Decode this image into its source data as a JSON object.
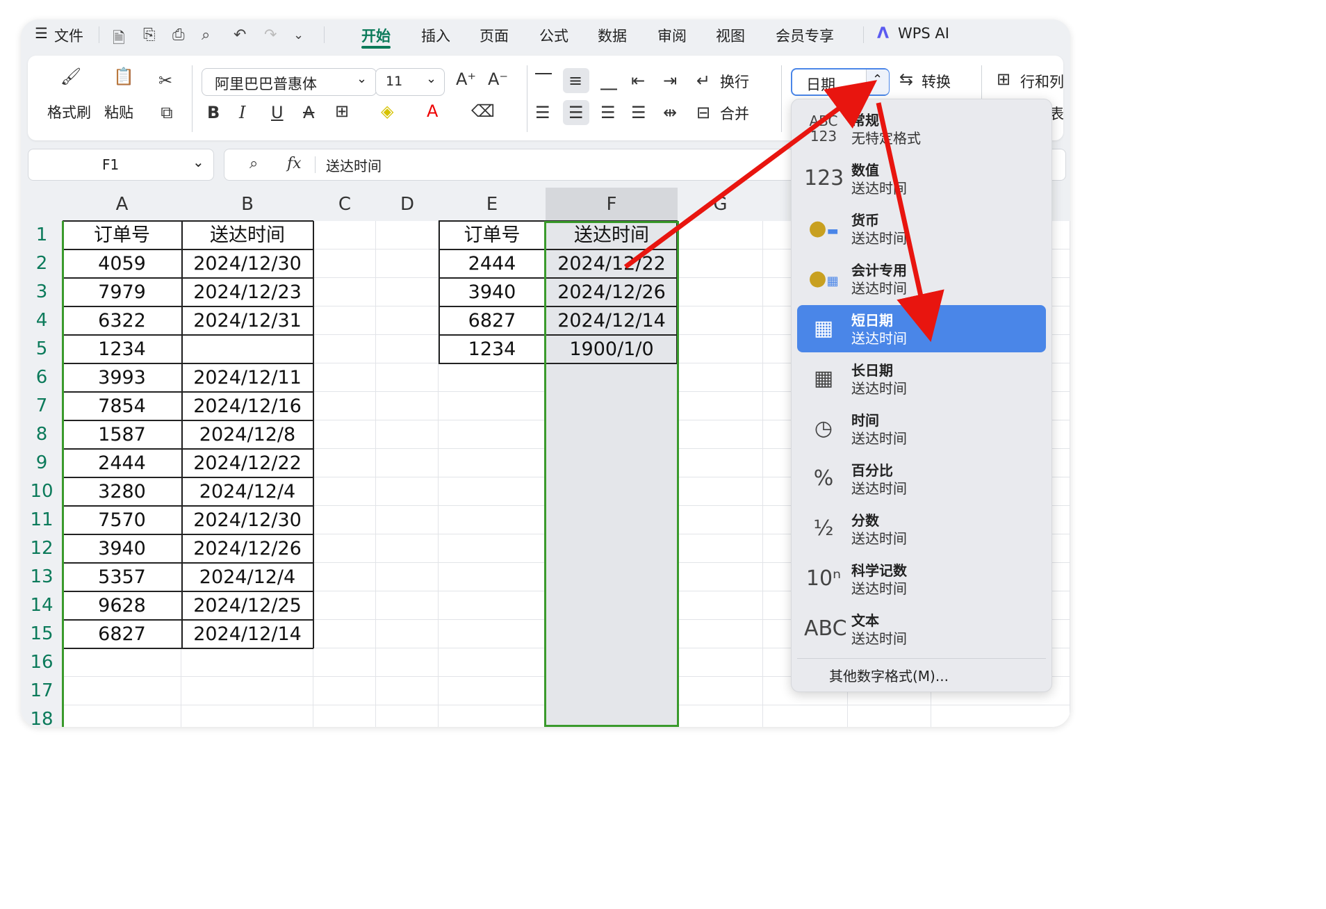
{
  "menu": {
    "hamburger": "☰",
    "file": "文件",
    "tabs": [
      "开始",
      "插入",
      "页面",
      "公式",
      "数据",
      "审阅",
      "视图",
      "会员专享"
    ],
    "active_tab": "开始",
    "ai": "WPS AI"
  },
  "ribbon": {
    "format_painter": "格式刷",
    "paste": "粘贴",
    "font_name": "阿里巴巴普惠体",
    "font_size": "11",
    "wrap": "换行",
    "merge": "合并",
    "number_format": "日期",
    "convert": "转换",
    "row_col": "行和列",
    "table_partial": "表"
  },
  "formula_bar": {
    "cell_ref": "F1",
    "fx": "fx",
    "content": "送达时间"
  },
  "sheet": {
    "columns": [
      "A",
      "B",
      "C",
      "D",
      "E",
      "F",
      "G"
    ],
    "rows": [
      "1",
      "2",
      "3",
      "4",
      "5",
      "6",
      "7",
      "8",
      "9",
      "10",
      "11",
      "12",
      "13",
      "14",
      "15",
      "16",
      "17",
      "18"
    ],
    "table1": {
      "headers": [
        "订单号",
        "送达时间"
      ],
      "rows": [
        [
          "4059",
          "2024/12/30"
        ],
        [
          "7979",
          "2024/12/23"
        ],
        [
          "6322",
          "2024/12/31"
        ],
        [
          "1234",
          ""
        ],
        [
          "3993",
          "2024/12/11"
        ],
        [
          "7854",
          "2024/12/16"
        ],
        [
          "1587",
          "2024/12/8"
        ],
        [
          "2444",
          "2024/12/22"
        ],
        [
          "3280",
          "2024/12/4"
        ],
        [
          "7570",
          "2024/12/30"
        ],
        [
          "3940",
          "2024/12/26"
        ],
        [
          "5357",
          "2024/12/4"
        ],
        [
          "9628",
          "2024/12/25"
        ],
        [
          "6827",
          "2024/12/14"
        ]
      ]
    },
    "table2": {
      "headers": [
        "订单号",
        "送达时间"
      ],
      "rows": [
        [
          "2444",
          "2024/12/22"
        ],
        [
          "3940",
          "2024/12/26"
        ],
        [
          "6827",
          "2024/12/14"
        ],
        [
          "1234",
          "1900/1/0"
        ]
      ]
    }
  },
  "dropdown": {
    "items": [
      {
        "icon": "ABC123",
        "name": "常规",
        "sub": "无特定格式"
      },
      {
        "icon": "123",
        "name": "数值",
        "sub": "送达时间"
      },
      {
        "icon": "coins",
        "name": "货币",
        "sub": "送达时间"
      },
      {
        "icon": "coins-calc",
        "name": "会计专用",
        "sub": "送达时间"
      },
      {
        "icon": "calendar",
        "name": "短日期",
        "sub": "送达时间"
      },
      {
        "icon": "calendar",
        "name": "长日期",
        "sub": "送达时间"
      },
      {
        "icon": "clock",
        "name": "时间",
        "sub": "送达时间"
      },
      {
        "icon": "%",
        "name": "百分比",
        "sub": "送达时间"
      },
      {
        "icon": "½",
        "name": "分数",
        "sub": "送达时间"
      },
      {
        "icon": "10ⁿ",
        "name": "科学记数",
        "sub": "送达时间"
      },
      {
        "icon": "ABC",
        "name": "文本",
        "sub": "送达时间"
      }
    ],
    "selected": "短日期",
    "more": "其他数字格式(M)..."
  },
  "colors": {
    "accent": "#0b7a5a",
    "selection": "#4a86e8",
    "arrow": "#e8150f"
  }
}
